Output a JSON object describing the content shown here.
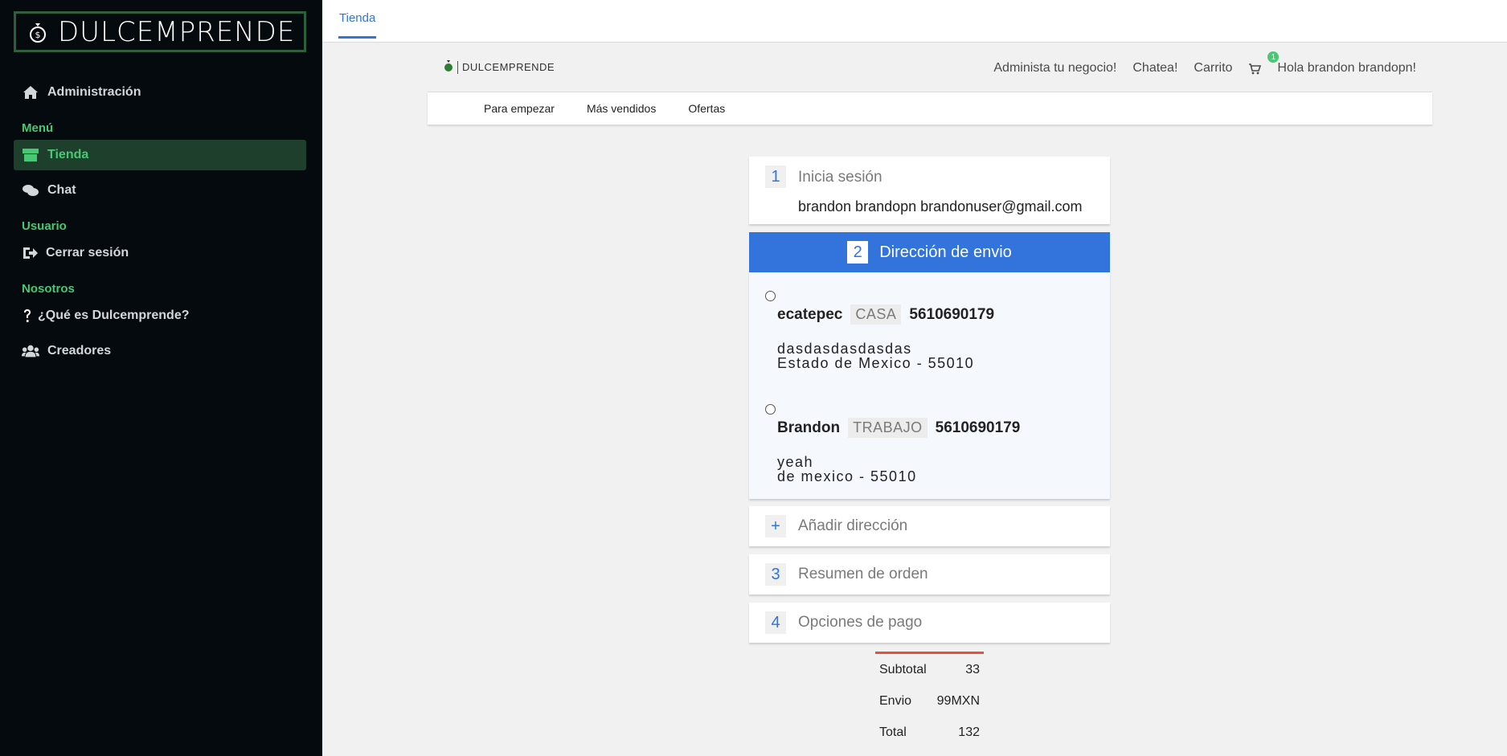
{
  "sidebar": {
    "brand": "DULCEMPRENDE",
    "admin_label": "Administración",
    "sections": {
      "menu": "Menú",
      "user": "Usuario",
      "about": "Nosotros"
    },
    "items": {
      "store": "Tienda",
      "chat": "Chat",
      "logout": "Cerrar sesión",
      "what_is": "¿Qué es Dulcemprende?",
      "creators": "Creadores"
    }
  },
  "topbar": {
    "tab": "Tienda"
  },
  "store_header": {
    "logo_text": "DULCEMPRENDE",
    "links": {
      "manage": "Administa tu negocio!",
      "chat": "Chatea!",
      "cart": "Carrito",
      "greeting": "Hola brandon brandopn!"
    },
    "cart_count": "1"
  },
  "subnav": {
    "items": [
      "Para empezar",
      "Más vendidos",
      "Ofertas"
    ]
  },
  "checkout": {
    "step1": {
      "num": "1",
      "title": "Inicia sesión",
      "info": "brandon brandopn brandonuser@gmail.com"
    },
    "step2": {
      "num": "2",
      "title": "Dirección de envio"
    },
    "addresses": [
      {
        "name": "ecatepec",
        "tag": "CASA",
        "phone": "5610690179",
        "street": "dasdasdasdasdas",
        "region": "Estado de Mexico - 55010"
      },
      {
        "name": "Brandon",
        "tag": "TRABAJO",
        "phone": "5610690179",
        "street": "yeah",
        "region": "de mexico - 55010"
      }
    ],
    "add_address": {
      "num": "+",
      "title": "Añadir dirección"
    },
    "step3": {
      "num": "3",
      "title": "Resumen de orden"
    },
    "step4": {
      "num": "4",
      "title": "Opciones de pago"
    }
  },
  "summary": {
    "subtotal_label": "Subtotal",
    "subtotal_value": "33",
    "shipping_label": "Envio",
    "shipping_value": "99MXN",
    "total_label": "Total",
    "total_value": "132"
  },
  "colors": {
    "sidebar_bg": "#050a0e",
    "accent_green": "#48c774",
    "accent_blue": "#3273dc",
    "summary_line": "#e8503a"
  }
}
